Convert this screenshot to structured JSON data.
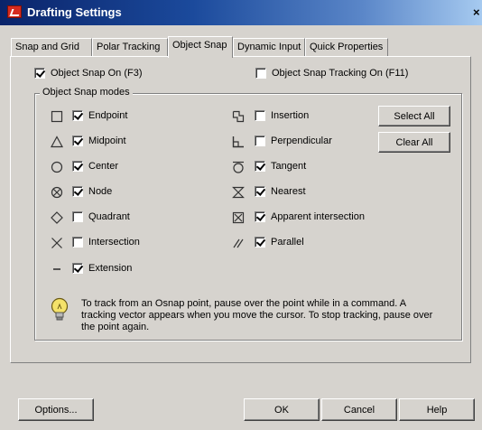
{
  "window": {
    "title": "Drafting Settings",
    "close_glyph": "×"
  },
  "tabs": [
    {
      "label": "Snap and Grid",
      "active": false
    },
    {
      "label": "Polar Tracking",
      "active": false
    },
    {
      "label": "Object Snap",
      "active": true
    },
    {
      "label": "Dynamic Input",
      "active": false
    },
    {
      "label": "Quick Properties",
      "active": false
    }
  ],
  "options": {
    "osnap_on": {
      "label": "Object Snap On (F3)",
      "checked": true
    },
    "osnap_tracking": {
      "label": "Object Snap Tracking On (F11)",
      "checked": false
    }
  },
  "group": {
    "title": "Object Snap modes",
    "left_modes": [
      {
        "label": "Endpoint",
        "checked": true,
        "icon": "endpoint-square-icon"
      },
      {
        "label": "Midpoint",
        "checked": true,
        "icon": "midpoint-triangle-icon"
      },
      {
        "label": "Center",
        "checked": true,
        "icon": "center-circle-icon"
      },
      {
        "label": "Node",
        "checked": true,
        "icon": "node-circled-x-icon"
      },
      {
        "label": "Quadrant",
        "checked": false,
        "icon": "quadrant-diamond-icon"
      },
      {
        "label": "Intersection",
        "checked": false,
        "icon": "intersection-x-icon"
      },
      {
        "label": "Extension",
        "checked": true,
        "icon": "extension-dash-icon"
      }
    ],
    "right_modes": [
      {
        "label": "Insertion",
        "checked": false,
        "icon": "insertion-icon"
      },
      {
        "label": "Perpendicular",
        "checked": false,
        "icon": "perpendicular-icon"
      },
      {
        "label": "Tangent",
        "checked": true,
        "icon": "tangent-icon"
      },
      {
        "label": "Nearest",
        "checked": true,
        "icon": "nearest-hourglass-icon"
      },
      {
        "label": "Apparent intersection",
        "checked": true,
        "icon": "apparent-intersection-icon"
      },
      {
        "label": "Parallel",
        "checked": true,
        "icon": "parallel-icon"
      }
    ],
    "select_all": "Select All",
    "clear_all": "Clear All",
    "info_icon": "lightbulb-icon",
    "info_text": "To track from an Osnap point, pause over the point while in a command.  A tracking vector appears when you move the cursor.  To stop tracking, pause over the point again."
  },
  "footer": {
    "options": "Options...",
    "ok": "OK",
    "cancel": "Cancel",
    "help": "Help"
  }
}
